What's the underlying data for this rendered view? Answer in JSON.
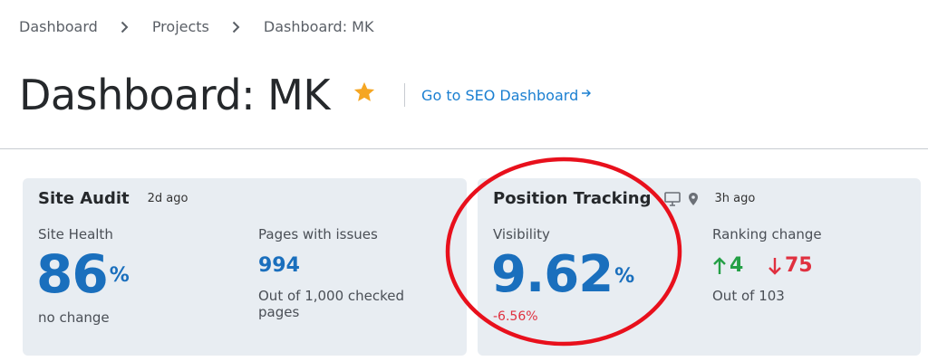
{
  "breadcrumb": {
    "items": [
      "Dashboard",
      "Projects",
      "Dashboard: MK"
    ]
  },
  "header": {
    "title": "Dashboard: MK",
    "seo_link": "Go to SEO Dashboard"
  },
  "site_audit": {
    "title": "Site Audit",
    "time": "2d ago",
    "health_label": "Site Health",
    "health_value": "86",
    "health_unit": "%",
    "health_note": "no change",
    "pages_label": "Pages with issues",
    "pages_value": "994",
    "pages_note": "Out of 1,000 checked pages"
  },
  "position_tracking": {
    "title": "Position Tracking",
    "time": "3h ago",
    "device_icon": "desktop-icon",
    "location_icon": "location-pin-icon",
    "visibility_label": "Visibility",
    "visibility_value": "9.62",
    "visibility_unit": "%",
    "visibility_change": "-6.56%",
    "ranking_label": "Ranking change",
    "ranking_up": "4",
    "ranking_down": "75",
    "ranking_note": "Out of 103"
  },
  "colors": {
    "accent_blue": "#1a6fbd",
    "link_blue": "#1a7fd1",
    "up_green": "#24a046",
    "down_red": "#e0303f",
    "star_orange": "#f5a623",
    "card_bg": "#e8edf2",
    "annotation_red": "#e8101c"
  }
}
